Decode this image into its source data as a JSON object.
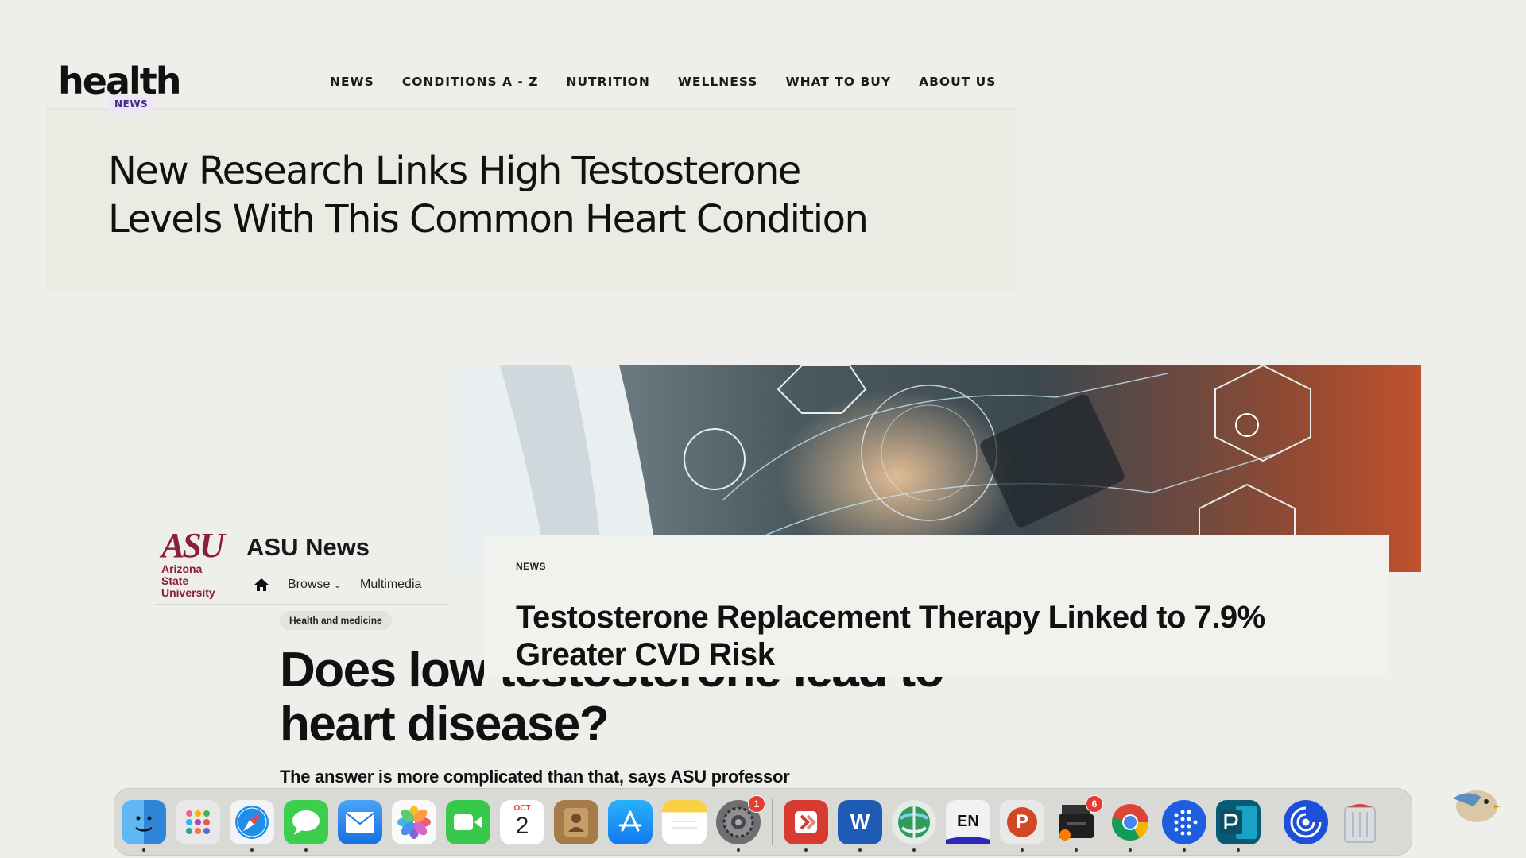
{
  "health": {
    "logo": "health",
    "nav": [
      "NEWS",
      "CONDITIONS A - Z",
      "NUTRITION",
      "WELLNESS",
      "WHAT TO BUY",
      "ABOUT US"
    ],
    "tag": "NEWS",
    "title_line1": "New Research Links High Testosterone",
    "title_line2": "Levels With This Common Heart Condition"
  },
  "asu": {
    "logo_mark": "ASU",
    "logo_sub1": "Arizona State",
    "logo_sub2": "University",
    "site_title": "ASU News",
    "nav_browse": "Browse",
    "nav_multimedia": "Multimedia",
    "tag": "Health and medicine",
    "headline_line1": "Does low testosterone lead to",
    "headline_line2": "heart disease?",
    "subhead": "The answer is more complicated than that, says ASU professor"
  },
  "trt": {
    "tag": "NEWS",
    "title_line1": "Testosterone Replacement Therapy Linked to 7.9%",
    "title_line2": "Greater CVD Risk"
  },
  "dock": {
    "calendar_month": "OCT",
    "calendar_day": "2",
    "settings_badge": "1",
    "printer_badge": "6",
    "lang_label": "EN",
    "word_label": "W",
    "ppt_label": "P",
    "items": [
      "finder-icon",
      "launchpad-icon",
      "safari-icon",
      "messages-icon",
      "mail-icon",
      "photos-icon",
      "facetime-icon",
      "calendar-icon",
      "contacts-icon",
      "app-store-icon",
      "notes-icon",
      "system-settings-icon",
      "remote-desktop-icon",
      "word-icon",
      "network-icon",
      "input-language-icon",
      "powerpoint-icon",
      "printer-icon",
      "chrome-icon",
      "audio-icon",
      "publisher-icon",
      "backup-icon",
      "trash-icon"
    ]
  }
}
